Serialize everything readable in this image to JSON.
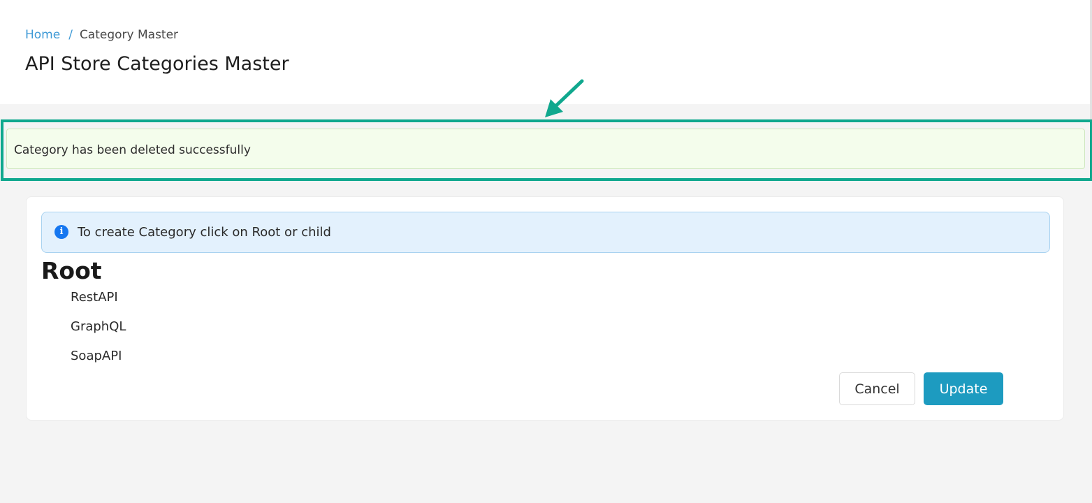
{
  "breadcrumb": {
    "home": "Home",
    "separator": "/",
    "current": "Category Master"
  },
  "page": {
    "title": "API Store Categories Master"
  },
  "success_alert": {
    "message": "Category has been deleted successfully"
  },
  "info_alert": {
    "icon": "info-icon",
    "message": "To create Category click on Root or child"
  },
  "tree": {
    "root": "Root",
    "children": [
      "RestAPI",
      "GraphQL",
      "SoapAPI"
    ]
  },
  "actions": {
    "cancel_label": "Cancel",
    "update_label": "Update"
  },
  "colors": {
    "annotation": "#10a88e",
    "update_button": "#1d9bc0",
    "info_icon": "#1677f0",
    "breadcrumb_link": "#3f9ad6"
  }
}
